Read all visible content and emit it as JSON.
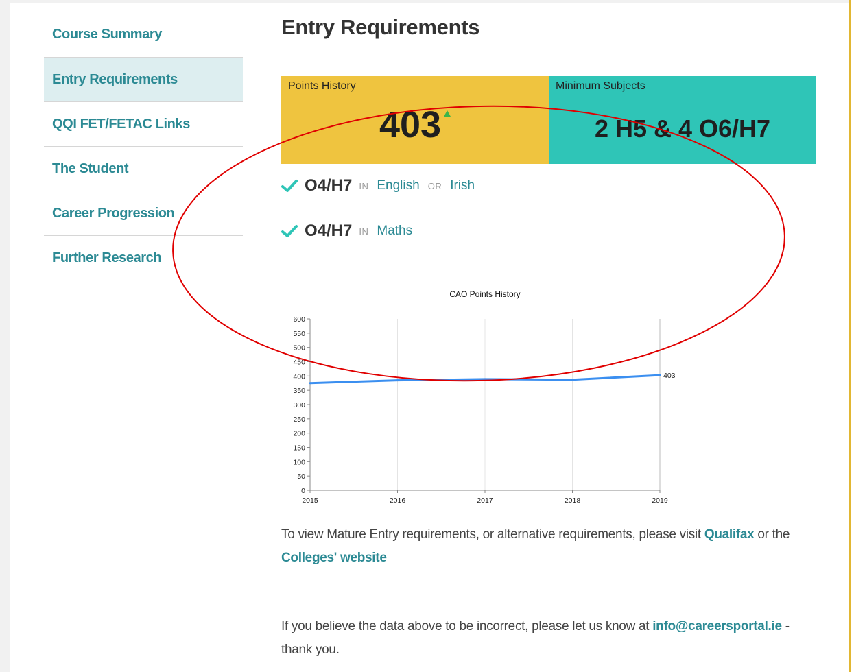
{
  "sidebar": {
    "items": [
      {
        "label": "Course Summary"
      },
      {
        "label": "Entry Requirements"
      },
      {
        "label": "QQI FET/FETAC Links"
      },
      {
        "label": "The Student"
      },
      {
        "label": "Career Progression"
      },
      {
        "label": "Further Research"
      }
    ],
    "active_index": 1
  },
  "main": {
    "title": "Entry Requirements",
    "points_box": {
      "label": "Points History",
      "value": "403",
      "trend": "up"
    },
    "subjects_box": {
      "label": "Minimum Subjects",
      "value": "2 H5 & 4 O6/H7"
    },
    "requirements": [
      {
        "grade": "O4/H7",
        "in_label": "IN",
        "subject_1": "English",
        "or_label": "OR",
        "subject_2": "Irish"
      },
      {
        "grade": "O4/H7",
        "in_label": "IN",
        "subject_1": "Maths"
      }
    ],
    "mature_text": {
      "before": "To view Mature Entry requirements, or alternative requirements, please visit ",
      "link_1": "Qualifax",
      "middle": " or the ",
      "link_2": "Colleges' website"
    },
    "contact_text": {
      "before": "If you believe the data above to be incorrect, please let us know at ",
      "email": "info@careersportal.ie",
      "after": " - thank you."
    }
  },
  "chart_data": {
    "type": "line",
    "title": "CAO Points History",
    "x": [
      "2015",
      "2016",
      "2017",
      "2018",
      "2019"
    ],
    "series": [
      {
        "values": [
          375,
          385,
          389,
          387,
          403
        ]
      }
    ],
    "last_point_label": "403",
    "ylim": [
      0,
      600
    ],
    "yticks": [
      0,
      50,
      100,
      150,
      200,
      250,
      300,
      350,
      400,
      450,
      500,
      550,
      600
    ],
    "grid": "vertical",
    "line_color": "#3b8ff0"
  },
  "colors": {
    "accent": "#2c8a94",
    "points_box": "#efc43f",
    "subjects_box": "#2fc5b7",
    "annotation_ellipse": "#e00000"
  }
}
